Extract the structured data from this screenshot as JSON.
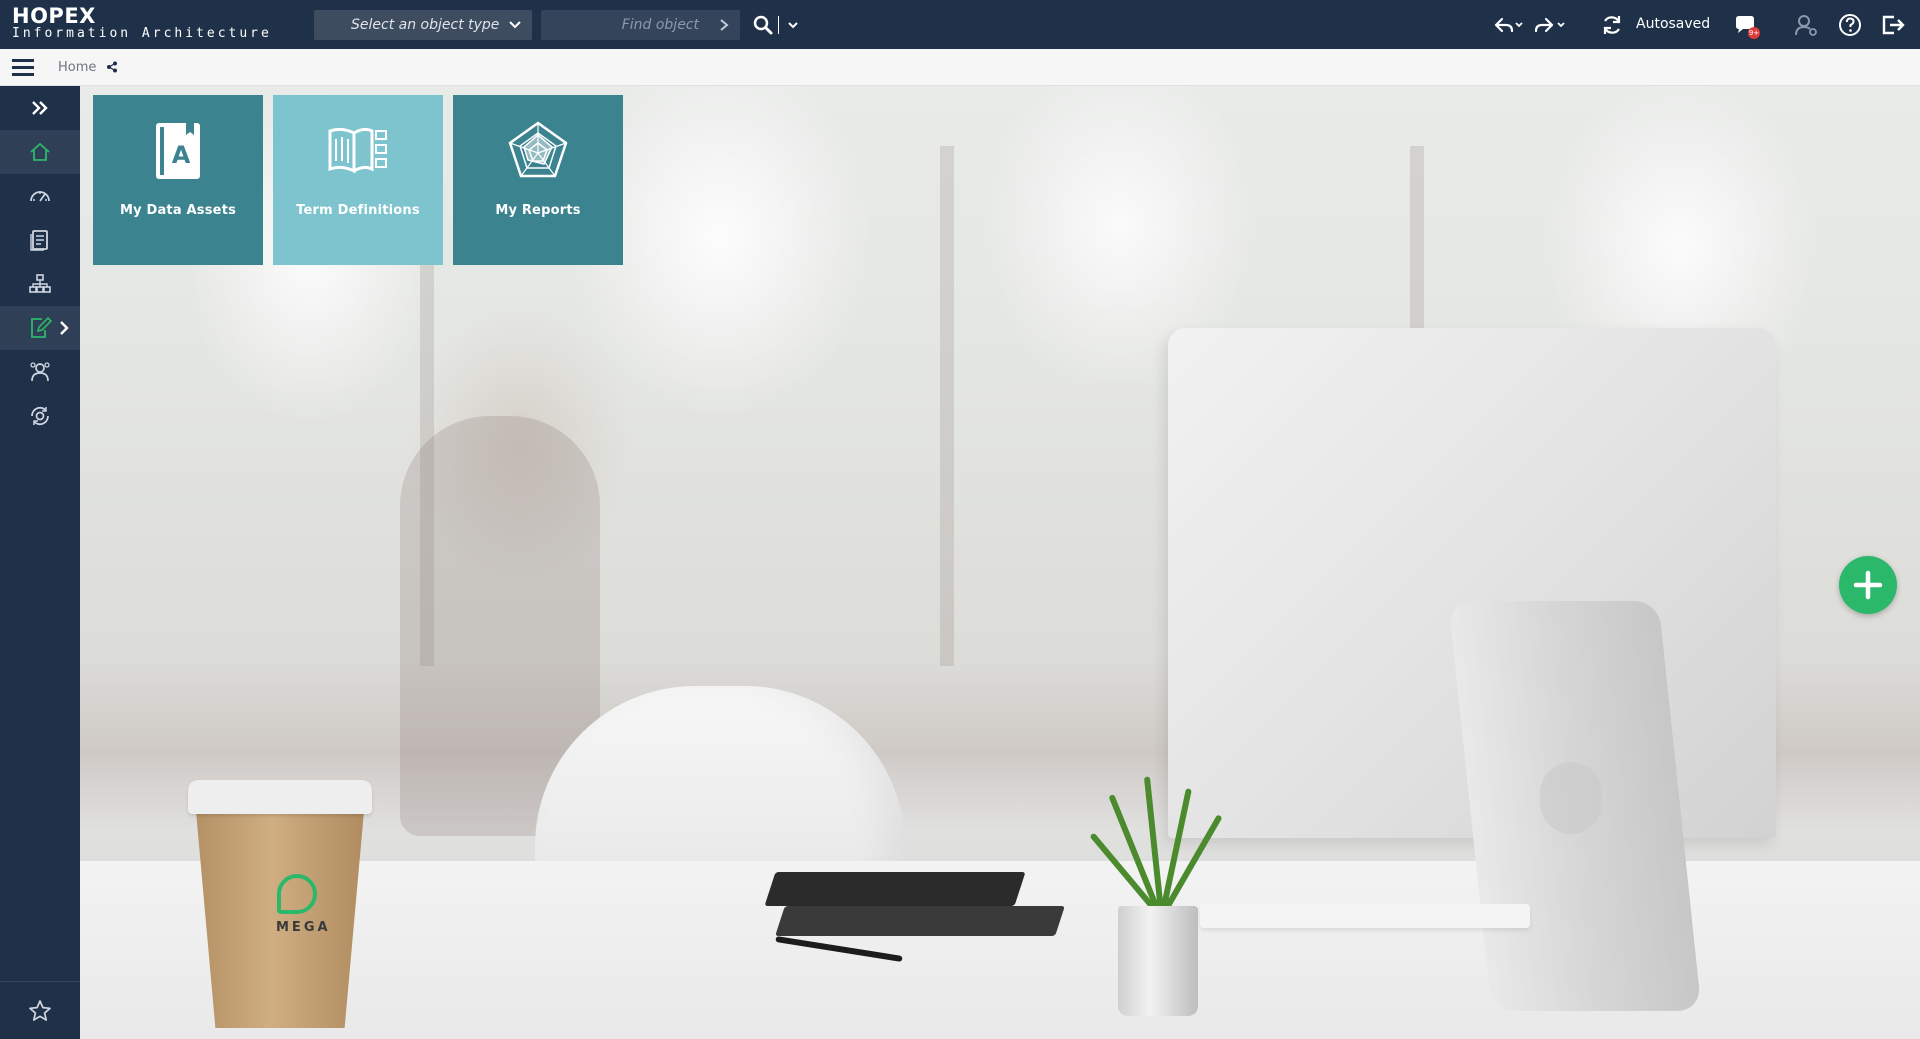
{
  "app": {
    "name": "HOPEX",
    "subtitle": "Information Architecture"
  },
  "toolbar": {
    "object_type_placeholder": "Select an object type",
    "find_object_placeholder": "Find object",
    "autosaved_label": "Autosaved",
    "notification_badge": "9+"
  },
  "breadcrumb": {
    "home": "Home"
  },
  "sidebar": {
    "items": [
      {
        "icon": "expand-icon"
      },
      {
        "icon": "home-icon",
        "state": "active"
      },
      {
        "icon": "dashboard-icon"
      },
      {
        "icon": "report-icon"
      },
      {
        "icon": "hierarchy-icon"
      },
      {
        "icon": "edit-document-icon",
        "state": "selected"
      },
      {
        "icon": "users-icon"
      },
      {
        "icon": "settings-cycle-icon"
      }
    ],
    "favorites_icon": "star-icon"
  },
  "tiles": [
    {
      "label": "My Data Assets",
      "icon": "book-a-icon",
      "color": "#3c8390"
    },
    {
      "label": "Term Definitions",
      "icon": "glossary-icon",
      "color": "#7ec4cf"
    },
    {
      "label": "My Reports",
      "icon": "radar-chart-icon",
      "color": "#3c8390"
    }
  ],
  "colors": {
    "topbar": "#1f3049",
    "accent_green": "#2bb86a",
    "tile_dark": "#3c8390",
    "tile_light": "#7ec4cf"
  },
  "background": {
    "cup_brand": "MEGA"
  }
}
